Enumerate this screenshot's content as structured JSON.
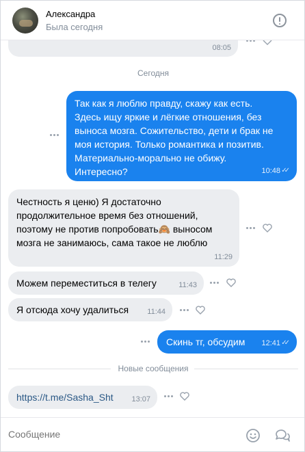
{
  "header": {
    "name": "Александра",
    "status": "Была сегодня"
  },
  "prev_message": {
    "time": "08:05"
  },
  "day_separator": "Сегодня",
  "messages": [
    {
      "dir": "out",
      "lines": [
        "Так как я люблю правду, скажу как есть.",
        "Здесь ищу яркие и лёгкие отношения, без",
        "выноса мозга. Сожительство, дети и брак не",
        "моя история. Только романтика и позитив.",
        "Материально-морально не обижу.",
        "Интересно?"
      ],
      "time": "10:48"
    },
    {
      "dir": "in",
      "lines": [
        "Честность я ценю) Я достаточно",
        "продолжительное время без отношений,",
        "поэтому не против попробовать🙈 выносом",
        "мозга не занимаюсь, сама такое не люблю"
      ],
      "time": "11:29"
    },
    {
      "dir": "in",
      "text": "Можем переместиться в телегу",
      "time": "11:43"
    },
    {
      "dir": "in",
      "text": "Я отсюда хочу удалиться",
      "time": "11:44"
    },
    {
      "dir": "out",
      "text": "Скинь тг, обсудим",
      "time": "12:41"
    }
  ],
  "new_messages_label": "Новые сообщения",
  "link_message": {
    "text": "https://t.me/Sasha_Sht",
    "time": "13:07"
  },
  "composer": {
    "placeholder": "Сообщение"
  },
  "icons": {
    "info": "info-icon",
    "more": "more-dots-icon",
    "like": "heart-icon",
    "emoji": "smile-icon",
    "templates": "chat-bubbles-icon",
    "read": "double-check-icon"
  },
  "colors": {
    "outgoing_bubble": "#1a82ee",
    "incoming_bubble": "#ebedf0",
    "secondary_text": "#818c99",
    "link": "#2a5885"
  }
}
